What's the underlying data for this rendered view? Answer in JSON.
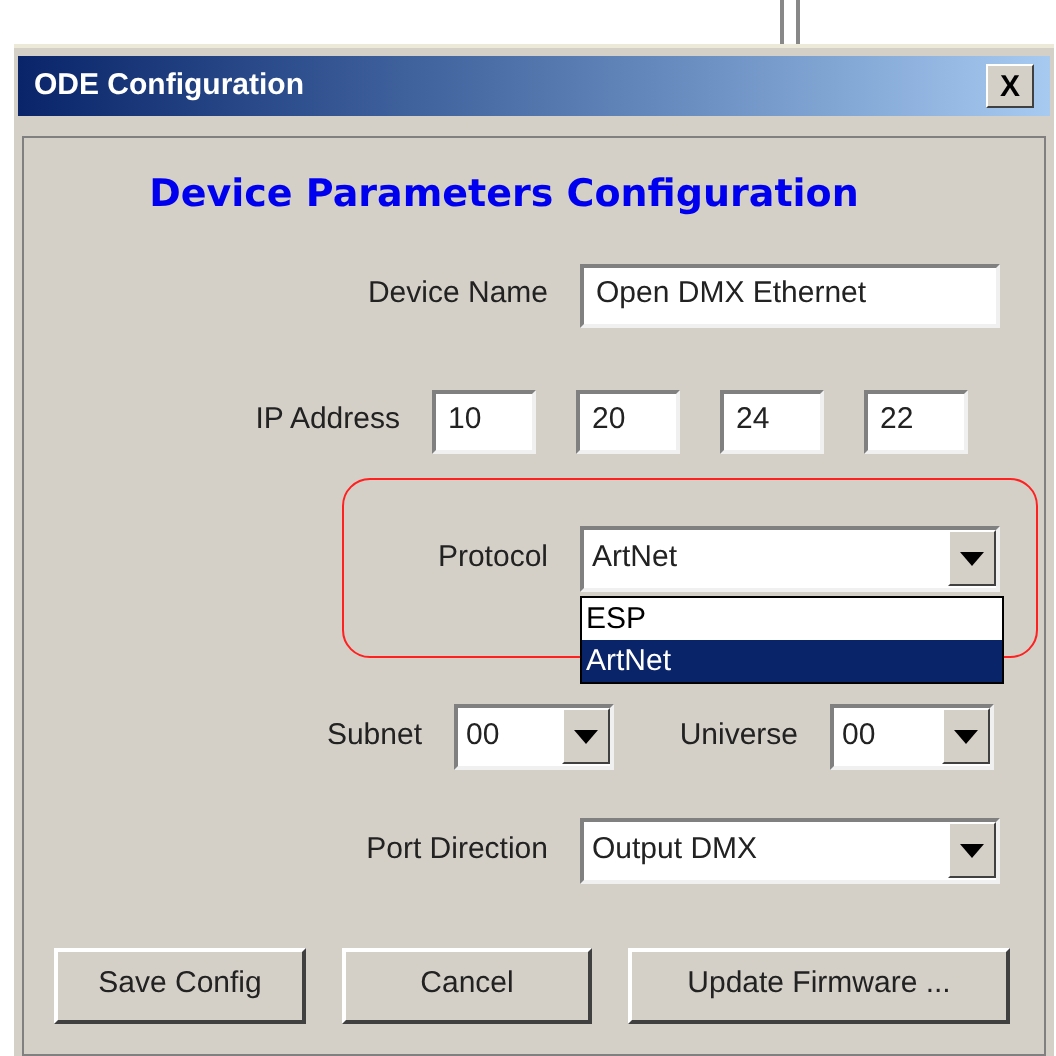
{
  "window": {
    "title": "ODE Configuration",
    "close": "X"
  },
  "heading": "Device Parameters Configuration",
  "device_name": {
    "label": "Device Name",
    "value": "Open DMX Ethernet"
  },
  "ip_address": {
    "label": "IP Address",
    "octets": [
      "10",
      "20",
      "24",
      "22"
    ]
  },
  "protocol": {
    "label": "Protocol",
    "value": "ArtNet",
    "expanded": true,
    "options": [
      {
        "label": "ESP",
        "selected": false
      },
      {
        "label": "ArtNet",
        "selected": true
      }
    ]
  },
  "subnet": {
    "label": "Subnet",
    "value": "00"
  },
  "universe": {
    "label": "Universe",
    "value": "00"
  },
  "port_direction": {
    "label": "Port Direction",
    "value": "Output DMX"
  },
  "buttons": [
    "Save Config",
    "Cancel",
    "Update Firmware ..."
  ]
}
